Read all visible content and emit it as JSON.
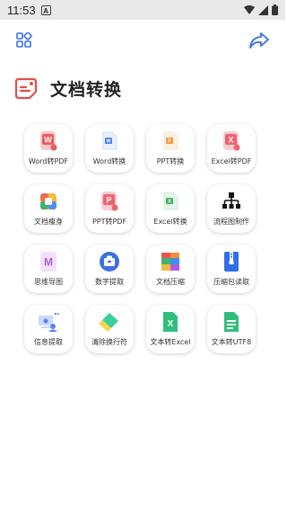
{
  "status_bar": {
    "time": "11:53",
    "app_badge": "A"
  },
  "header": {
    "title": "文档转换"
  },
  "tools": [
    {
      "label": "Word转PDF",
      "icon": "word-to-pdf-icon",
      "color": "#e85c5c"
    },
    {
      "label": "Word转换",
      "icon": "word-icon",
      "color": "#4a7ff0"
    },
    {
      "label": "PPT转换",
      "icon": "ppt-icon",
      "color": "#f39a3c"
    },
    {
      "label": "Excel转PDF",
      "icon": "excel-to-pdf-icon",
      "color": "#ec6470"
    },
    {
      "label": "文档瘦身",
      "icon": "doc-slim-icon",
      "color": "#f5b940"
    },
    {
      "label": "PPT转PDF",
      "icon": "ppt-to-pdf-icon",
      "color": "#ec6470"
    },
    {
      "label": "Excel转换",
      "icon": "excel-icon",
      "color": "#42b36a"
    },
    {
      "label": "流程图制作",
      "icon": "flowchart-icon",
      "color": "#111111"
    },
    {
      "label": "思维导图",
      "icon": "mindmap-icon",
      "color": "#b05ce0"
    },
    {
      "label": "数字提取",
      "icon": "number-extract-icon",
      "color": "#3f6fe0"
    },
    {
      "label": "文档压缩",
      "icon": "doc-compress-icon",
      "color": "#e9564b"
    },
    {
      "label": "压缩包读取",
      "icon": "zip-read-icon",
      "color": "#2f6fe8"
    },
    {
      "label": "信息提取",
      "icon": "info-extract-icon",
      "color": "#5b84e8"
    },
    {
      "label": "清除换行符",
      "icon": "clear-linebreak-icon",
      "color": "#3ccf9c"
    },
    {
      "label": "文本转Excel",
      "icon": "text-to-excel-icon",
      "color": "#2fbf7a"
    },
    {
      "label": "文本转UTF8",
      "icon": "text-to-utf8-icon",
      "color": "#2fbf7a"
    }
  ]
}
